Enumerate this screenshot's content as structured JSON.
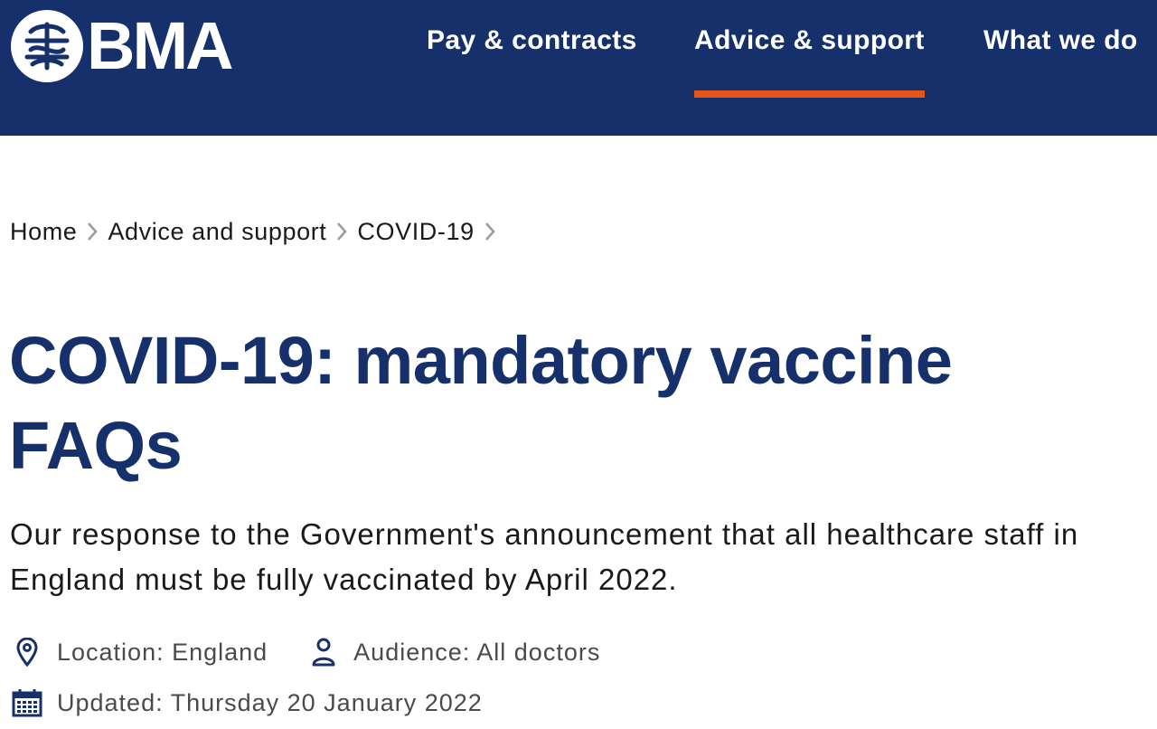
{
  "header": {
    "logo_text": "BMA",
    "nav": [
      {
        "label": "Pay & contracts",
        "active": false
      },
      {
        "label": "Advice & support",
        "active": true
      },
      {
        "label": "What we do",
        "active": false
      }
    ]
  },
  "breadcrumb": [
    "Home",
    "Advice and support",
    "COVID-19"
  ],
  "page": {
    "title": "COVID-19: mandatory vaccine FAQs",
    "intro": "Our response to the Government's announcement that all healthcare staff in England must be fully vaccinated by April 2022."
  },
  "meta": {
    "location": "Location: England",
    "audience": "Audience: All doctors",
    "updated": "Updated: Thursday 20 January 2022"
  },
  "colors": {
    "brand_navy": "#16306c",
    "accent_orange": "#e8541a",
    "text_dark": "#1a1a1a",
    "meta_grey": "#4a4a4a"
  },
  "icons": {
    "logo": "bma-logo-icon",
    "breadcrumb_separator": "chevron-right-icon",
    "location": "location-pin-icon",
    "audience": "person-icon",
    "updated": "calendar-icon"
  }
}
